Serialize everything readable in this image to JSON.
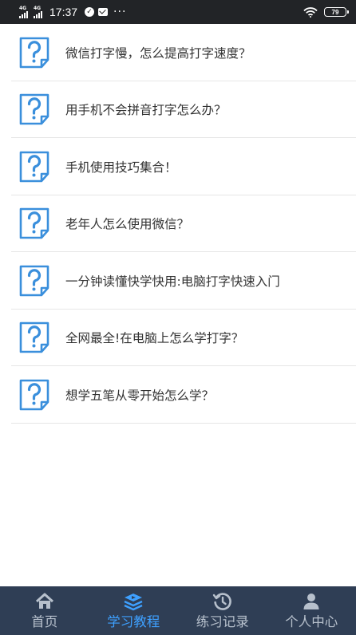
{
  "status_bar": {
    "network_1": "4G",
    "network_2": "4G",
    "time": "17:37",
    "dots": "···",
    "battery": "79"
  },
  "questions": [
    {
      "label": "微信打字慢，怎么提高打字速度？"
    },
    {
      "label": "用手机不会拼音打字怎么办？"
    },
    {
      "label": "手机使用技巧集合！"
    },
    {
      "label": "老年人怎么使用微信？"
    },
    {
      "label": "一分钟读懂快学快用:电脑打字快速入门"
    },
    {
      "label": "全网最全!在电脑上怎么学打字？"
    },
    {
      "label": "想学五笔从零开始怎么学？"
    }
  ],
  "tabs": [
    {
      "label": "首页",
      "icon": "home-icon"
    },
    {
      "label": "学习教程",
      "icon": "play-layers-icon",
      "active": true
    },
    {
      "label": "练习记录",
      "icon": "history-icon"
    },
    {
      "label": "个人中心",
      "icon": "person-icon"
    }
  ],
  "colors": {
    "status_bar": "#222427",
    "tab_bar": "#2f3e55",
    "tab_active": "#3ea0ff",
    "tab_inactive": "#b7c0cc",
    "question_icon": "#3a8fdc"
  }
}
